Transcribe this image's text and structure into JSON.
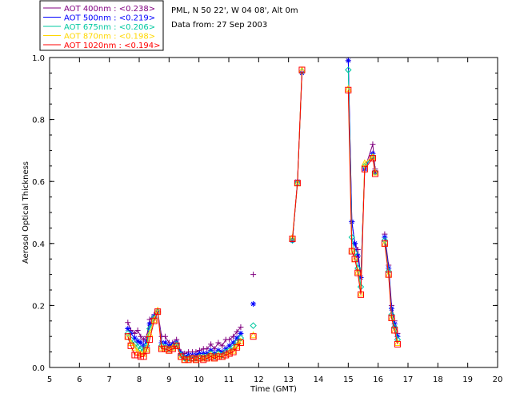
{
  "chart_data": {
    "type": "line",
    "title": "PML, N 50 22', W 04 08', Alt 0m",
    "subtitle": "Data from: 27 Sep 2003",
    "xlabel": "Time (GMT)",
    "ylabel": "Aerosol Optical Thickness",
    "xlim": [
      5,
      20
    ],
    "ylim": [
      0,
      1.0
    ],
    "xticks": [
      "5",
      "6",
      "7",
      "8",
      "9",
      "10",
      "11",
      "12",
      "13",
      "14",
      "15",
      "16",
      "17",
      "18",
      "19",
      "20"
    ],
    "yticks": [
      "0.0",
      "0.2",
      "0.4",
      "0.6",
      "0.8",
      "1.0"
    ],
    "legend_position": "top-left outside",
    "series": [
      {
        "name": "AOT  400nm : <0.238>",
        "color": "#800080",
        "marker": "plus",
        "points": [
          [
            7.62,
            0.145
          ],
          [
            7.72,
            0.12
          ],
          [
            7.85,
            0.11
          ],
          [
            7.95,
            0.12
          ],
          [
            8.05,
            0.1
          ],
          [
            8.15,
            0.09
          ],
          [
            8.25,
            0.1
          ],
          [
            8.35,
            0.155
          ],
          [
            8.5,
            0.17
          ],
          [
            8.62,
            0.18
          ],
          [
            8.75,
            0.1
          ],
          [
            8.87,
            0.1
          ],
          [
            9.0,
            0.08
          ],
          [
            9.12,
            0.08
          ],
          [
            9.25,
            0.09
          ],
          [
            9.4,
            0.05
          ],
          [
            9.52,
            0.045
          ],
          [
            9.65,
            0.05
          ],
          [
            9.78,
            0.05
          ],
          [
            9.9,
            0.05
          ],
          [
            10.02,
            0.055
          ],
          [
            10.15,
            0.06
          ],
          [
            10.27,
            0.06
          ],
          [
            10.4,
            0.075
          ],
          [
            10.52,
            0.06
          ],
          [
            10.65,
            0.08
          ],
          [
            10.78,
            0.07
          ],
          [
            10.9,
            0.09
          ],
          [
            11.02,
            0.09
          ],
          [
            11.15,
            0.1
          ],
          [
            11.27,
            0.115
          ],
          [
            11.4,
            0.13
          ],
          null,
          [
            11.82,
            0.3
          ],
          null,
          [
            13.13,
            0.41
          ],
          [
            13.3,
            0.6
          ],
          [
            13.45,
            0.95
          ],
          null,
          [
            15.0,
            0.99
          ],
          [
            15.12,
            0.47
          ],
          [
            15.22,
            0.4
          ],
          [
            15.32,
            0.38
          ],
          [
            15.42,
            0.29
          ],
          [
            15.55,
            0.64
          ],
          [
            15.82,
            0.72
          ],
          [
            15.9,
            0.64
          ],
          null,
          [
            16.22,
            0.43
          ],
          [
            16.35,
            0.33
          ],
          [
            16.45,
            0.2
          ],
          [
            16.55,
            0.15
          ],
          [
            16.65,
            0.11
          ]
        ]
      },
      {
        "name": "AOT  500nm : <0.219>",
        "color": "#0000ff",
        "marker": "star",
        "points": [
          [
            7.62,
            0.125
          ],
          [
            7.72,
            0.11
          ],
          [
            7.85,
            0.095
          ],
          [
            7.95,
            0.085
          ],
          [
            8.05,
            0.08
          ],
          [
            8.15,
            0.07
          ],
          [
            8.25,
            0.085
          ],
          [
            8.35,
            0.14
          ],
          [
            8.5,
            0.165
          ],
          [
            8.62,
            0.18
          ],
          [
            8.75,
            0.08
          ],
          [
            8.87,
            0.08
          ],
          [
            9.0,
            0.07
          ],
          [
            9.12,
            0.075
          ],
          [
            9.25,
            0.08
          ],
          [
            9.4,
            0.045
          ],
          [
            9.52,
            0.035
          ],
          [
            9.65,
            0.04
          ],
          [
            9.78,
            0.04
          ],
          [
            9.9,
            0.04
          ],
          [
            10.02,
            0.045
          ],
          [
            10.15,
            0.045
          ],
          [
            10.27,
            0.045
          ],
          [
            10.4,
            0.055
          ],
          [
            10.52,
            0.045
          ],
          [
            10.65,
            0.055
          ],
          [
            10.78,
            0.05
          ],
          [
            10.9,
            0.06
          ],
          [
            11.02,
            0.07
          ],
          [
            11.15,
            0.08
          ],
          [
            11.27,
            0.095
          ],
          [
            11.4,
            0.11
          ],
          null,
          [
            11.82,
            0.205
          ],
          null,
          [
            13.13,
            0.41
          ],
          [
            13.3,
            0.6
          ],
          [
            13.45,
            0.95
          ],
          null,
          [
            15.0,
            0.99
          ],
          [
            15.12,
            0.47
          ],
          [
            15.22,
            0.4
          ],
          [
            15.32,
            0.36
          ],
          [
            15.42,
            0.29
          ],
          [
            15.55,
            0.64
          ],
          [
            15.82,
            0.69
          ],
          [
            15.9,
            0.63
          ],
          null,
          [
            16.22,
            0.42
          ],
          [
            16.35,
            0.32
          ],
          [
            16.45,
            0.19
          ],
          [
            16.55,
            0.14
          ],
          [
            16.65,
            0.1
          ]
        ]
      },
      {
        "name": "AOT  675nm : <0.206>",
        "color": "#00c8a0",
        "marker": "diamond",
        "points": [
          [
            7.62,
            0.11
          ],
          [
            7.72,
            0.09
          ],
          [
            7.85,
            0.075
          ],
          [
            7.95,
            0.065
          ],
          [
            8.05,
            0.06
          ],
          [
            8.15,
            0.055
          ],
          [
            8.25,
            0.07
          ],
          [
            8.35,
            0.125
          ],
          [
            8.5,
            0.16
          ],
          [
            8.62,
            0.18
          ],
          [
            8.75,
            0.07
          ],
          [
            8.87,
            0.065
          ],
          [
            9.0,
            0.06
          ],
          [
            9.12,
            0.065
          ],
          [
            9.25,
            0.075
          ],
          [
            9.4,
            0.04
          ],
          [
            9.52,
            0.03
          ],
          [
            9.65,
            0.03
          ],
          [
            9.78,
            0.03
          ],
          [
            9.9,
            0.03
          ],
          [
            10.02,
            0.035
          ],
          [
            10.15,
            0.035
          ],
          [
            10.27,
            0.035
          ],
          [
            10.4,
            0.045
          ],
          [
            10.52,
            0.035
          ],
          [
            10.65,
            0.045
          ],
          [
            10.78,
            0.04
          ],
          [
            10.9,
            0.05
          ],
          [
            11.02,
            0.055
          ],
          [
            11.15,
            0.065
          ],
          [
            11.27,
            0.08
          ],
          [
            11.4,
            0.095
          ],
          null,
          [
            11.82,
            0.135
          ],
          null,
          [
            13.13,
            0.41
          ],
          [
            13.3,
            0.595
          ],
          [
            13.45,
            0.955
          ],
          null,
          [
            15.0,
            0.96
          ],
          [
            15.12,
            0.42
          ],
          [
            15.22,
            0.37
          ],
          [
            15.32,
            0.32
          ],
          [
            15.42,
            0.26
          ],
          [
            15.55,
            0.65
          ],
          [
            15.82,
            0.68
          ],
          [
            15.9,
            0.63
          ],
          null,
          [
            16.22,
            0.41
          ],
          [
            16.35,
            0.31
          ],
          [
            16.45,
            0.17
          ],
          [
            16.55,
            0.13
          ],
          [
            16.65,
            0.09
          ]
        ]
      },
      {
        "name": "AOT  870nm : <0.198>",
        "color": "#ffd700",
        "marker": "triangle",
        "points": [
          [
            7.62,
            0.1
          ],
          [
            7.72,
            0.08
          ],
          [
            7.85,
            0.065
          ],
          [
            7.95,
            0.05
          ],
          [
            8.05,
            0.045
          ],
          [
            8.15,
            0.045
          ],
          [
            8.25,
            0.06
          ],
          [
            8.35,
            0.11
          ],
          [
            8.5,
            0.155
          ],
          [
            8.62,
            0.185
          ],
          [
            8.75,
            0.065
          ],
          [
            8.87,
            0.06
          ],
          [
            9.0,
            0.055
          ],
          [
            9.12,
            0.065
          ],
          [
            9.25,
            0.07
          ],
          [
            9.4,
            0.035
          ],
          [
            9.52,
            0.025
          ],
          [
            9.65,
            0.025
          ],
          [
            9.78,
            0.03
          ],
          [
            9.9,
            0.025
          ],
          [
            10.02,
            0.03
          ],
          [
            10.15,
            0.03
          ],
          [
            10.27,
            0.03
          ],
          [
            10.4,
            0.04
          ],
          [
            10.52,
            0.03
          ],
          [
            10.65,
            0.04
          ],
          [
            10.78,
            0.035
          ],
          [
            10.9,
            0.04
          ],
          [
            11.02,
            0.05
          ],
          [
            11.15,
            0.055
          ],
          [
            11.27,
            0.07
          ],
          [
            11.4,
            0.085
          ],
          null,
          [
            11.82,
            0.105
          ],
          null,
          [
            13.13,
            0.42
          ],
          [
            13.3,
            0.595
          ],
          [
            13.45,
            0.96
          ],
          null,
          [
            15.0,
            0.9
          ],
          [
            15.12,
            0.38
          ],
          [
            15.22,
            0.35
          ],
          [
            15.32,
            0.31
          ],
          [
            15.42,
            0.24
          ],
          [
            15.55,
            0.66
          ],
          [
            15.82,
            0.68
          ],
          [
            15.9,
            0.63
          ],
          null,
          [
            16.22,
            0.4
          ],
          [
            16.35,
            0.3
          ],
          [
            16.45,
            0.16
          ],
          [
            16.55,
            0.12
          ],
          [
            16.65,
            0.08
          ]
        ]
      },
      {
        "name": "AOT 1020nm : <0.194>",
        "color": "#ff0000",
        "marker": "square",
        "points": [
          [
            7.62,
            0.1
          ],
          [
            7.72,
            0.07
          ],
          [
            7.85,
            0.04
          ],
          [
            7.95,
            0.04
          ],
          [
            8.05,
            0.035
          ],
          [
            8.15,
            0.035
          ],
          [
            8.25,
            0.055
          ],
          [
            8.35,
            0.09
          ],
          [
            8.5,
            0.15
          ],
          [
            8.62,
            0.18
          ],
          [
            8.75,
            0.06
          ],
          [
            8.87,
            0.06
          ],
          [
            9.0,
            0.055
          ],
          [
            9.12,
            0.06
          ],
          [
            9.25,
            0.07
          ],
          [
            9.4,
            0.035
          ],
          [
            9.52,
            0.025
          ],
          [
            9.65,
            0.025
          ],
          [
            9.78,
            0.03
          ],
          [
            9.9,
            0.025
          ],
          [
            10.02,
            0.03
          ],
          [
            10.15,
            0.025
          ],
          [
            10.27,
            0.03
          ],
          [
            10.4,
            0.035
          ],
          [
            10.52,
            0.03
          ],
          [
            10.65,
            0.035
          ],
          [
            10.78,
            0.035
          ],
          [
            10.9,
            0.04
          ],
          [
            11.02,
            0.045
          ],
          [
            11.15,
            0.05
          ],
          [
            11.27,
            0.065
          ],
          [
            11.4,
            0.08
          ],
          null,
          [
            11.82,
            0.1
          ],
          null,
          [
            13.13,
            0.415
          ],
          [
            13.3,
            0.595
          ],
          [
            13.45,
            0.96
          ],
          null,
          [
            15.0,
            0.895
          ],
          [
            15.12,
            0.375
          ],
          [
            15.22,
            0.35
          ],
          [
            15.32,
            0.305
          ],
          [
            15.42,
            0.235
          ],
          [
            15.55,
            0.64
          ],
          [
            15.82,
            0.675
          ],
          [
            15.9,
            0.625
          ],
          null,
          [
            16.22,
            0.4
          ],
          [
            16.35,
            0.3
          ],
          [
            16.45,
            0.16
          ],
          [
            16.55,
            0.12
          ],
          [
            16.65,
            0.075
          ]
        ]
      }
    ]
  }
}
